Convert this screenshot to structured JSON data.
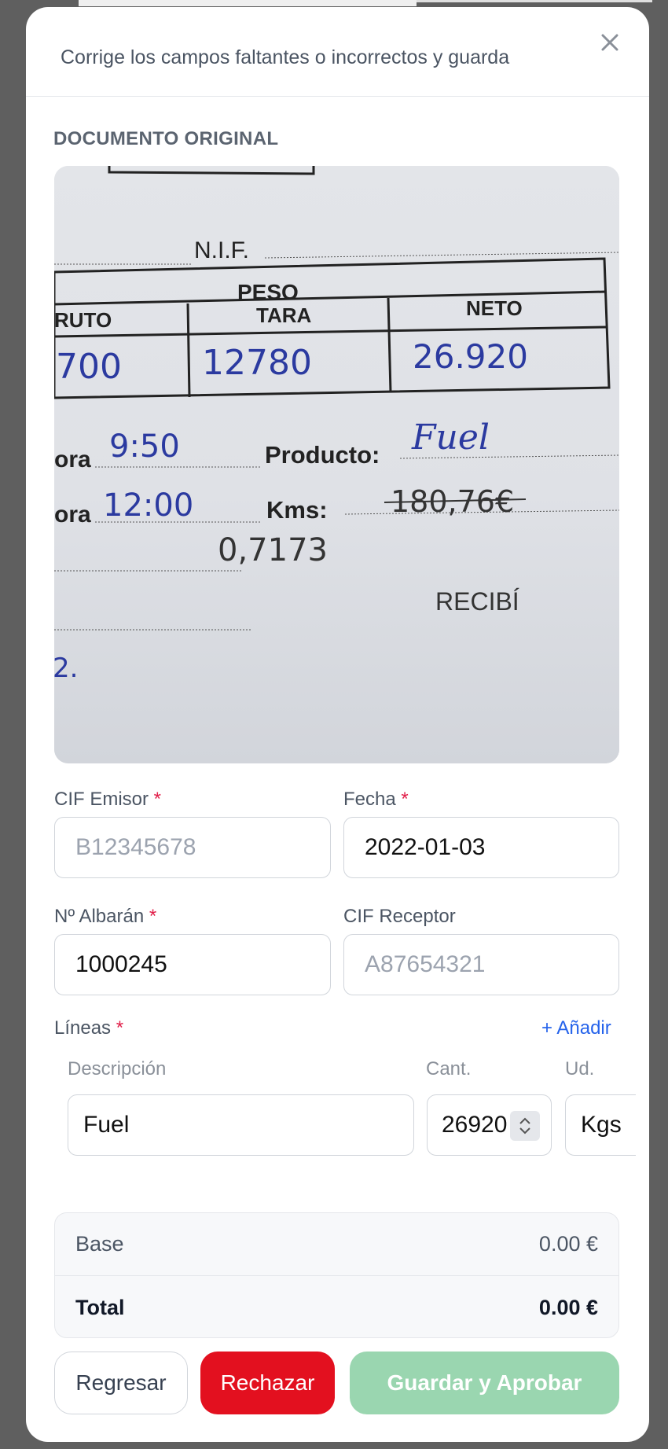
{
  "header": {
    "subtitle": "Corrige los campos faltantes o incorrectos y guarda"
  },
  "document": {
    "section_label": "DOCUMENTO ORIGINAL",
    "photo": {
      "nif": "N.I.F.",
      "peso": "PESO",
      "bruto": "RUTO",
      "tara": "TARA",
      "neto": "NETO",
      "bruto_value": "700",
      "tara_value": "12780",
      "neto_value": "26.920",
      "hora1_label": "ora",
      "hora1_value": "9:50",
      "producto_label": "Producto:",
      "producto_value": "Fuel",
      "hora2_label": "ora",
      "hora2_value": "12:00",
      "kms_label": "Kms:",
      "kms_value": "180,76€",
      "extra_value": "0,7173",
      "recibi": "RECIBÍ",
      "mark": "2."
    }
  },
  "form": {
    "cif_emisor": {
      "label": "CIF Emisor",
      "required": "*",
      "placeholder": "B12345678"
    },
    "fecha": {
      "label": "Fecha",
      "required": "*",
      "value": "2022-01-03"
    },
    "albaran": {
      "label": "Nº Albarán",
      "required": "*",
      "value": "1000245"
    },
    "cif_receptor": {
      "label": "CIF Receptor",
      "placeholder": "A87654321"
    },
    "lineas": {
      "label": "Líneas",
      "required": "*",
      "add_label": "+ Añadir",
      "col_desc": "Descripción",
      "col_qty": "Cant.",
      "col_unit": "Ud.",
      "items": [
        {
          "description": "Fuel",
          "quantity": "26920",
          "unit": "Kgs"
        }
      ]
    }
  },
  "totals": {
    "base_label": "Base",
    "base_value": "0.00 €",
    "total_label": "Total",
    "total_value": "0.00 €"
  },
  "actions": {
    "back": "Regresar",
    "reject": "Rechazar",
    "save": "Guardar y Aprobar"
  },
  "colors": {
    "accent_blue": "#2563eb",
    "reject_red": "#e3101f",
    "save_green_disabled": "#9ad6b0",
    "required_red": "#e11d48"
  }
}
